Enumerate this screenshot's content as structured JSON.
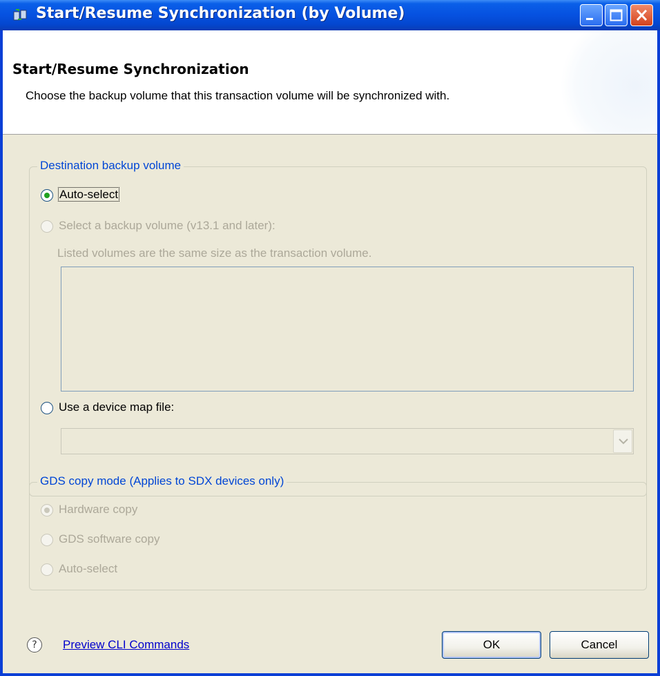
{
  "window": {
    "title": "Start/Resume Synchronization (by Volume)",
    "colors": {
      "titlebar": "#0651e0",
      "client_bg": "#ece9d8",
      "link": "#0000cc",
      "group_legend": "#0046d5",
      "close_button": "#d4421c"
    }
  },
  "titlebar_buttons": {
    "minimize_icon": "minimize-icon",
    "maximize_icon": "maximize-icon",
    "close_icon": "close-icon"
  },
  "header": {
    "title": "Start/Resume Synchronization",
    "description": "Choose the backup volume that this transaction volume will be synchronized with."
  },
  "destination_group": {
    "legend": "Destination backup volume",
    "options": [
      {
        "label": "Auto-select",
        "checked": true,
        "enabled": true
      },
      {
        "label": "Select a backup volume (v13.1 and later):",
        "checked": false,
        "enabled": false
      },
      {
        "label": "Use a device map file:",
        "checked": false,
        "enabled": true
      }
    ],
    "note": "Listed volumes are the same size as the transaction volume.",
    "volume_list_items": [],
    "device_map_combo_value": ""
  },
  "copy_mode_group": {
    "legend": "GDS copy mode (Applies to SDX devices only)",
    "options": [
      {
        "label": "Hardware copy",
        "checked": true,
        "enabled": false
      },
      {
        "label": "GDS software copy",
        "checked": false,
        "enabled": false
      },
      {
        "label": "Auto-select",
        "checked": false,
        "enabled": false
      }
    ]
  },
  "footer": {
    "help_icon": "help-icon",
    "help_symbol": "?",
    "preview_link": "Preview CLI Commands",
    "ok_label": "OK",
    "cancel_label": "Cancel"
  }
}
